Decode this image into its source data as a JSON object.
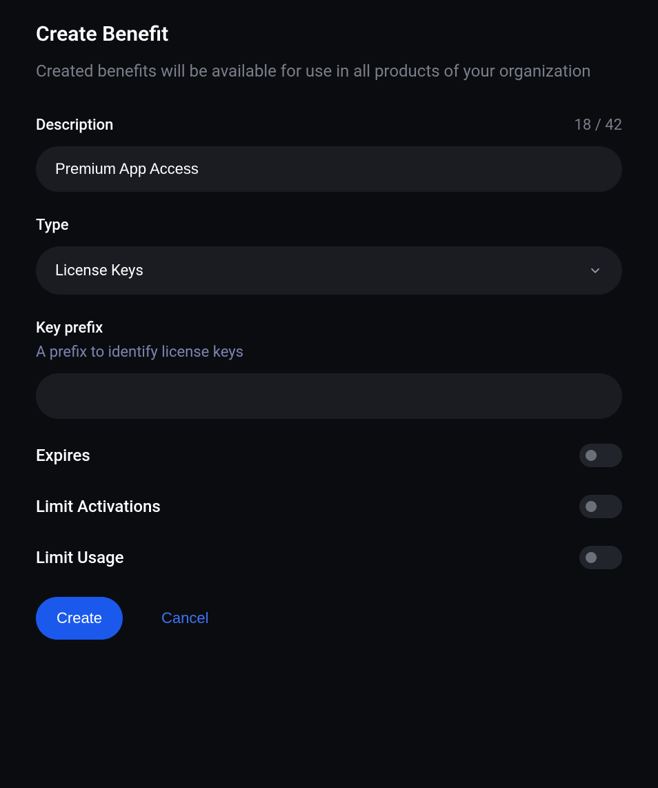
{
  "header": {
    "title": "Create Benefit",
    "subtitle": "Created benefits will be available for use in all products of your organization"
  },
  "description": {
    "label": "Description",
    "counter": "18 / 42",
    "value": "Premium App Access"
  },
  "type": {
    "label": "Type",
    "selected": "License Keys"
  },
  "keyPrefix": {
    "label": "Key prefix",
    "helper": "A prefix to identify license keys",
    "value": ""
  },
  "toggles": {
    "expires": {
      "label": "Expires",
      "on": false
    },
    "limitActivations": {
      "label": "Limit Activations",
      "on": false
    },
    "limitUsage": {
      "label": "Limit Usage",
      "on": false
    }
  },
  "actions": {
    "create": "Create",
    "cancel": "Cancel"
  }
}
